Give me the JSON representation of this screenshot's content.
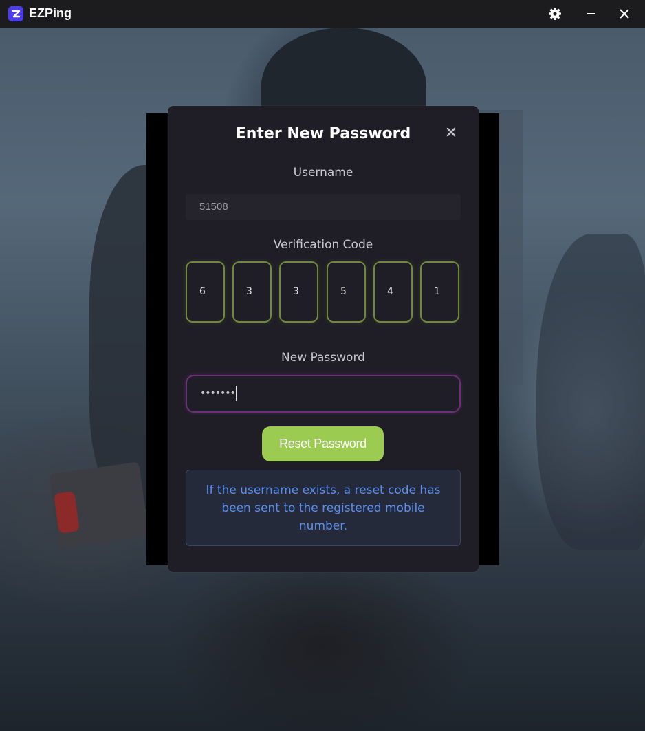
{
  "app": {
    "title": "EZPing",
    "icons": {
      "logo": "ezping-logo-icon",
      "settings": "gear-icon",
      "minimize": "minimize-icon",
      "close": "close-icon"
    }
  },
  "modal": {
    "title": "Enter New Password",
    "close_icon": "close-icon",
    "username": {
      "label": "Username",
      "value": "51508"
    },
    "verification": {
      "label": "Verification Code",
      "digits": [
        "6",
        "3",
        "3",
        "5",
        "4",
        "1"
      ]
    },
    "new_password": {
      "label": "New Password",
      "value": "•••••••"
    },
    "reset_button": "Reset Password",
    "info_message": "If the username exists, a reset code has been sent to the registered mobile number."
  },
  "colors": {
    "accent_green": "#9ccb52",
    "code_border": "#6f8a3a",
    "password_focus_border": "#6c2f78",
    "info_text": "#5a8ff0",
    "logo_purple": "#4b3cf0"
  }
}
